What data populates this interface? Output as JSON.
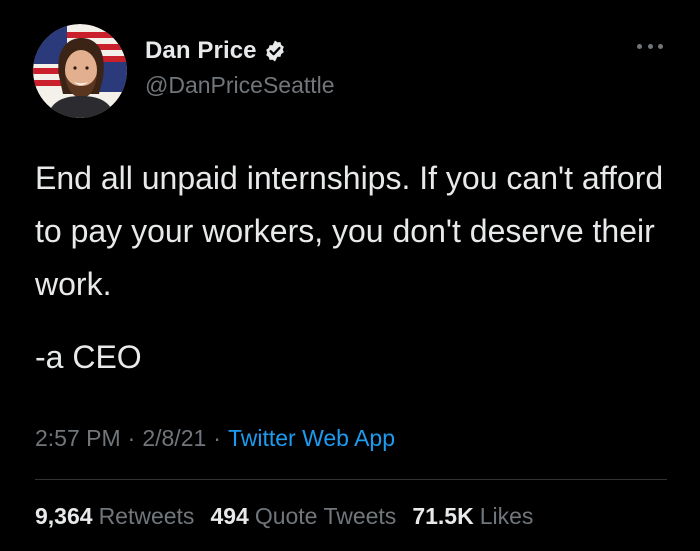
{
  "author": {
    "display_name": "Dan Price",
    "handle": "@DanPriceSeattle",
    "verified_icon": "verified-badge-icon",
    "verified_color": "#1d9bf0"
  },
  "tweet": {
    "text": "End all unpaid internships. If you can't afford to pay your workers, you don't deserve their work.",
    "signature": "-a CEO"
  },
  "meta": {
    "time": "2:57 PM",
    "date": "2/8/21",
    "separator": "·",
    "source": "Twitter Web App"
  },
  "stats": {
    "retweets_count": "9,364",
    "retweets_label": "Retweets",
    "quotes_count": "494",
    "quotes_label": "Quote Tweets",
    "likes_count": "71.5K",
    "likes_label": "Likes"
  },
  "colors": {
    "background": "#000000",
    "text_primary": "#e7e9ea",
    "text_secondary": "#71767b",
    "link": "#1d9bf0"
  }
}
